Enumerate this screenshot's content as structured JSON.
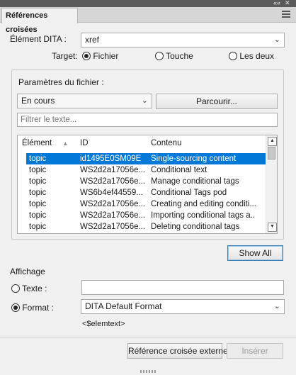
{
  "panel": {
    "tab_label": "Références croisées",
    "top_controls": [
      "««",
      "✕"
    ]
  },
  "element": {
    "label": "Élément DITA :",
    "value": "xref"
  },
  "target": {
    "label": "Target:",
    "options": [
      {
        "label": "Fichier",
        "selected": true
      },
      {
        "label": "Touche",
        "selected": false
      },
      {
        "label": "Les deux",
        "selected": false
      }
    ]
  },
  "file_params": {
    "label": "Paramètres du fichier :",
    "scope_value": "En cours",
    "browse_label": "Parcourir...",
    "filter_placeholder": "Filtrer le texte..."
  },
  "table": {
    "columns": [
      "Élément",
      "ID",
      "Contenu"
    ],
    "sort_indicator": "▲",
    "rows": [
      {
        "element": "topic",
        "id": "id1495E0SM09E",
        "content": "Single-sourcing content",
        "selected": true
      },
      {
        "element": "topic",
        "id": "WS2d2a17056e...",
        "content": "Conditional text",
        "selected": false
      },
      {
        "element": "topic",
        "id": "WS2d2a17056e...",
        "content": "Manage conditional tags",
        "selected": false
      },
      {
        "element": "topic",
        "id": "WS6b4ef44559...",
        "content": "Conditional Tags pod",
        "selected": false
      },
      {
        "element": "topic",
        "id": "WS2d2a17056e...",
        "content": "Creating and editing conditi...",
        "selected": false
      },
      {
        "element": "topic",
        "id": "WS2d2a17056e...",
        "content": "Importing conditional tags a...",
        "selected": false
      },
      {
        "element": "topic",
        "id": "WS2d2a17056e...",
        "content": "Deleting conditional tags",
        "selected": false
      }
    ]
  },
  "show_all_label": "Show All",
  "display": {
    "heading": "Affichage",
    "text_option": {
      "label": "Texte :",
      "selected": false,
      "value": ""
    },
    "format_option": {
      "label": "Format :",
      "selected": true
    },
    "format_value": "DITA Default Format",
    "preview": "<$elemtext>"
  },
  "footer": {
    "external_label": "Référence croisée externe",
    "insert_label": "Insérer"
  },
  "colors": {
    "selection": "#0078d7",
    "title_bar": "#5a5a5a",
    "background": "#f0f0f0"
  }
}
